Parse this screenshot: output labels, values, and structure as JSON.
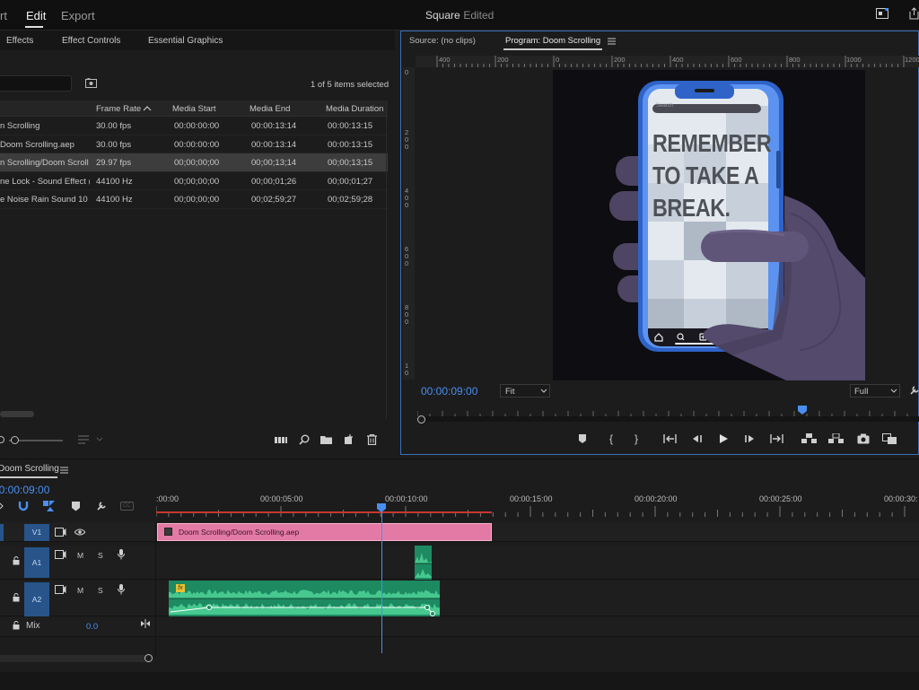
{
  "workspaces": {
    "import": "rt",
    "edit": "Edit",
    "export": "Export"
  },
  "title": {
    "name": "Square",
    "status": " - Edited"
  },
  "left_panel": {
    "tabs": [
      "Effects",
      "Effect Controls",
      "Essential Graphics"
    ],
    "selection_info": "1 of 5 items selected",
    "columns": [
      "Frame Rate",
      "Media Start",
      "Media End",
      "Media Duration"
    ],
    "rows": [
      {
        "name": "n Scrolling",
        "rate": "30.00 fps",
        "start": "00:00:00:00",
        "end": "00:00:13:14",
        "dur": "00:00:13:15"
      },
      {
        "name": "Doom Scrolling.aep",
        "rate": "30.00 fps",
        "start": "00:00:00:00",
        "end": "00:00:13:14",
        "dur": "00:00:13:15"
      },
      {
        "name": "n Scrolling/Doom Scroll",
        "rate": "29.97 fps",
        "start": "00;00;00;00",
        "end": "00;00;13;14",
        "dur": "00;00;13;15"
      },
      {
        "name": "ne Lock - Sound Effect (",
        "rate": "44100 Hz",
        "start": "00;00;00;00",
        "end": "00;00;01;26",
        "dur": "00;00;01;27"
      },
      {
        "name": "e Noise Rain Sound 10 [",
        "rate": "44100 Hz",
        "start": "00;00;00;00",
        "end": "00;02;59;27",
        "dur": "00;02;59;28"
      }
    ]
  },
  "program": {
    "source_tab": "Source: (no clips)",
    "program_tab": "Program: Doom Scrolling",
    "timecode": "00:00:09:00",
    "fit": "Fit",
    "quality": "Full",
    "ruler_ticks": [
      "400",
      "200",
      "0",
      "200",
      "400",
      "600",
      "800",
      "1000",
      "1200"
    ],
    "vruler": [
      "0",
      "2\n0\n0",
      "4\n0\n0",
      "6\n0\n0",
      "8\n0\n0",
      "1\n0"
    ],
    "phone": {
      "search": "Search",
      "line1": "REMEMBER",
      "line2": "TO TAKE A",
      "line3": "BREAK."
    }
  },
  "timeline": {
    "sequence": "Doom Scrolling",
    "timecode": "00:00:09:00",
    "ticks": [
      ":00:00",
      "00:00:05:00",
      "00:00:10:00",
      "00:00:15:00",
      "00:00:20:00",
      "00:00:25:00",
      "00:00:30:"
    ],
    "tracks": {
      "v1": "V1",
      "a1": "A1",
      "a2": "A2",
      "mix": "Mix",
      "mix_value": "0.0",
      "m": "M",
      "s": "S"
    },
    "clip_label": "Doom Scrolling/Doom Scrolling.aep",
    "fx": "fx"
  },
  "colors": {
    "accent": "#3b6fb8",
    "timecode": "#4a8ff0",
    "video_clip": "#e37aa5",
    "audio_clip": "#1d8a62",
    "playhead": "#4a8ff0"
  }
}
